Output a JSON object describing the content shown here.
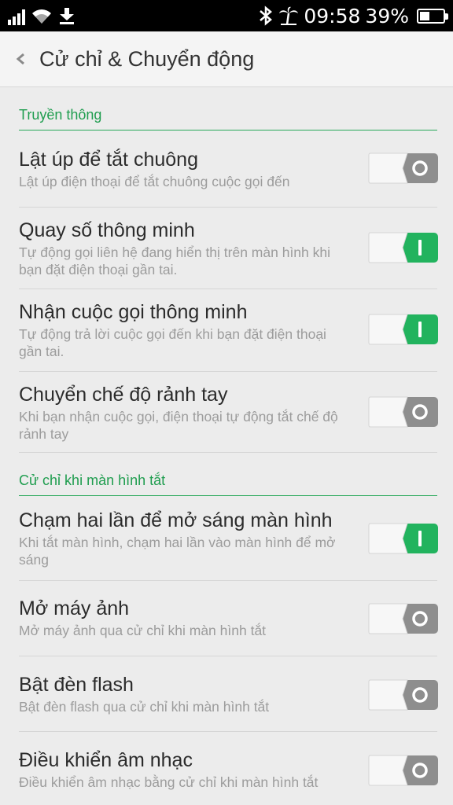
{
  "status_bar": {
    "time": "09:58",
    "battery_percent": "39%",
    "battery_level": 0.39,
    "icons": [
      "signal-icon",
      "wifi-icon",
      "download-icon",
      "bluetooth-icon",
      "palm-tree-icon",
      "battery-icon"
    ]
  },
  "app_bar": {
    "title": "Cử chỉ & Chuyển động",
    "back_icon": "chevron-left-icon"
  },
  "sections": [
    {
      "header": "Truyền thông",
      "items": [
        {
          "title": "Lật úp để tắt chuông",
          "subtitle": "Lật úp điện thoại để tắt chuông cuộc gọi đến",
          "enabled": false
        },
        {
          "title": "Quay số thông minh",
          "subtitle": "Tự động gọi liên hệ đang hiển thị trên màn hình khi bạn đặt điện thoại gần tai.",
          "enabled": true
        },
        {
          "title": "Nhận cuộc gọi thông minh",
          "subtitle": "Tự động trả lời cuộc gọi đến khi bạn đặt điện thoại gần tai.",
          "enabled": true
        },
        {
          "title": "Chuyển chế độ rảnh tay",
          "subtitle": "Khi bạn nhận cuộc gọi, điện thoại tự động tắt chế độ rảnh tay",
          "enabled": false
        }
      ]
    },
    {
      "header": "Cử chỉ khi màn hình tắt",
      "items": [
        {
          "title": "Chạm hai lần để mở sáng màn hình",
          "subtitle": "Khi tắt màn hình, chạm hai lần vào màn hình để mở sáng",
          "enabled": true
        },
        {
          "title": "Mở máy ảnh",
          "subtitle": "Mở máy ảnh qua cử chỉ khi màn hình tắt",
          "enabled": false
        },
        {
          "title": "Bật đèn flash",
          "subtitle": "Bật đèn flash qua cử chỉ khi màn hình tắt",
          "enabled": false
        },
        {
          "title": "Điều khiển âm nhạc",
          "subtitle": "Điều khiển âm nhạc bằng cử chỉ khi màn hình tắt",
          "enabled": false
        }
      ]
    }
  ],
  "colors": {
    "accent": "#1f9d4f",
    "toggle_on": "#22b35e",
    "toggle_off": "#8e8e8e",
    "background": "#ececec"
  }
}
